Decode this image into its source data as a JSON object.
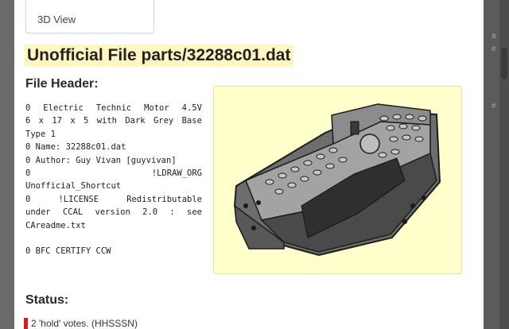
{
  "tabs": {
    "view3d_label": "3D View"
  },
  "page": {
    "title": "Unofficial File parts/32288c01.dat"
  },
  "file_header": {
    "heading": "File Header:",
    "lines": [
      [
        "0",
        "Electric",
        "Technic",
        "Motor",
        "4.5V"
      ],
      [
        "6",
        "x",
        "17",
        "x",
        "5",
        "with",
        "Dark",
        "Grey",
        "Base"
      ],
      [
        "Type 1"
      ],
      [
        "0 Name: 32288c01.dat"
      ],
      [
        "0 Author: Guy Vivan [guyvivan]"
      ],
      [
        "0",
        "!LDRAW_ORG"
      ],
      [
        "Unofficial_Shortcut"
      ],
      [
        "0",
        "!LICENSE",
        "Redistributable"
      ],
      [
        "under",
        "CCAL",
        "version",
        "2.0",
        ":",
        "see"
      ],
      [
        "CAreadme.txt"
      ],
      [],
      [
        "0 BFC CERTIFY CCW"
      ]
    ]
  },
  "status": {
    "heading": "Status:",
    "text": "2 'hold' votes. (HHSSSN)",
    "color": "#d81b1b"
  },
  "preview": {
    "background": "#ffffcc"
  },
  "right_fragments": [
    "a",
    "e",
    "#"
  ]
}
